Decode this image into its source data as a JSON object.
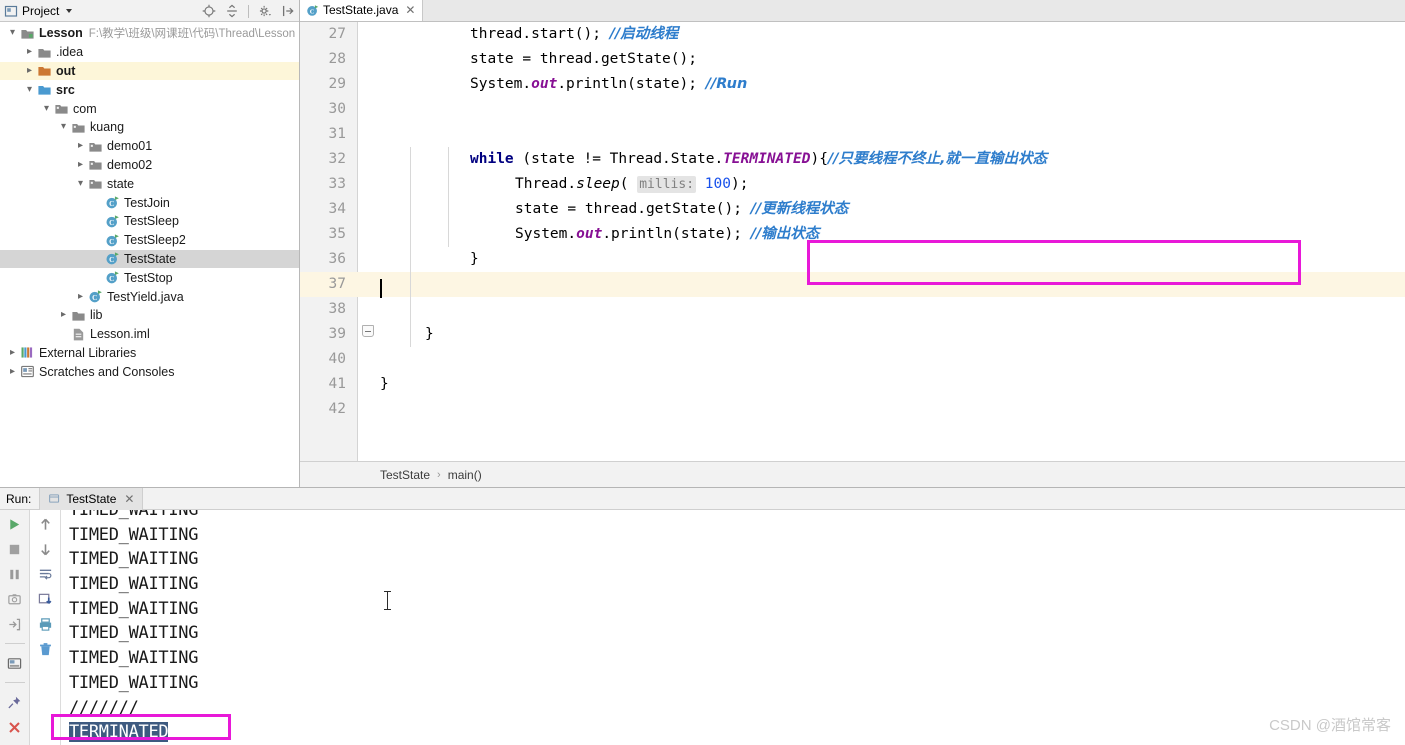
{
  "project_panel": {
    "title": "Project",
    "caret_icon": "chevron-down-icon",
    "tools": [
      {
        "name": "locate-icon",
        "title": "Select Opened File"
      },
      {
        "name": "collapse-all-icon",
        "title": "Collapse All"
      },
      {
        "name": "gear-icon",
        "title": "Settings"
      },
      {
        "name": "hide-icon",
        "title": "Hide"
      }
    ],
    "tree": [
      {
        "label": "Lesson",
        "path": "F:\\教学\\班级\\网课班\\代码\\Thread\\Lesson",
        "depth": 0,
        "arrow": "expanded",
        "icon": "module-icon",
        "bold": true,
        "state": "none"
      },
      {
        "label": ".idea",
        "path": "",
        "depth": 1,
        "arrow": "collapsed",
        "icon": "folder-icon",
        "bold": false,
        "state": "none"
      },
      {
        "label": "out",
        "path": "",
        "depth": 1,
        "arrow": "collapsed",
        "icon": "folder-orange-icon",
        "bold": true,
        "state": "highlight"
      },
      {
        "label": "src",
        "path": "",
        "depth": 1,
        "arrow": "expanded",
        "icon": "folder-source-icon",
        "bold": true,
        "state": "none"
      },
      {
        "label": "com",
        "path": "",
        "depth": 2,
        "arrow": "expanded",
        "icon": "package-icon",
        "bold": false,
        "state": "none"
      },
      {
        "label": "kuang",
        "path": "",
        "depth": 3,
        "arrow": "expanded",
        "icon": "package-icon",
        "bold": false,
        "state": "none"
      },
      {
        "label": "demo01",
        "path": "",
        "depth": 4,
        "arrow": "collapsed",
        "icon": "package-icon",
        "bold": false,
        "state": "none"
      },
      {
        "label": "demo02",
        "path": "",
        "depth": 4,
        "arrow": "collapsed",
        "icon": "package-icon",
        "bold": false,
        "state": "none"
      },
      {
        "label": "state",
        "path": "",
        "depth": 4,
        "arrow": "expanded",
        "icon": "package-icon",
        "bold": false,
        "state": "none"
      },
      {
        "label": "TestJoin",
        "path": "",
        "depth": 5,
        "arrow": "none",
        "icon": "java-class-icon",
        "bold": false,
        "state": "none"
      },
      {
        "label": "TestSleep",
        "path": "",
        "depth": 5,
        "arrow": "none",
        "icon": "java-class-icon",
        "bold": false,
        "state": "none"
      },
      {
        "label": "TestSleep2",
        "path": "",
        "depth": 5,
        "arrow": "none",
        "icon": "java-class-icon",
        "bold": false,
        "state": "none"
      },
      {
        "label": "TestState",
        "path": "",
        "depth": 5,
        "arrow": "none",
        "icon": "java-class-icon",
        "bold": false,
        "state": "selected"
      },
      {
        "label": "TestStop",
        "path": "",
        "depth": 5,
        "arrow": "none",
        "icon": "java-class-icon",
        "bold": false,
        "state": "none"
      },
      {
        "label": "TestYield.java",
        "path": "",
        "depth": 4,
        "arrow": "collapsed",
        "icon": "java-class-icon",
        "bold": false,
        "state": "none"
      },
      {
        "label": "lib",
        "path": "",
        "depth": 3,
        "arrow": "collapsed",
        "icon": "folder-icon",
        "bold": false,
        "state": "none"
      },
      {
        "label": "Lesson.iml",
        "path": "",
        "depth": 3,
        "arrow": "none",
        "icon": "iml-file-icon",
        "bold": false,
        "state": "none"
      },
      {
        "label": "External Libraries",
        "path": "",
        "depth": 0,
        "arrow": "collapsed",
        "icon": "libraries-icon",
        "bold": false,
        "state": "none"
      },
      {
        "label": "Scratches and Consoles",
        "path": "",
        "depth": 0,
        "arrow": "collapsed",
        "icon": "scratches-icon",
        "bold": false,
        "state": "none"
      }
    ]
  },
  "editor": {
    "tab": {
      "label": "TestState.java",
      "icon": "java-class-icon",
      "close_icon": "close-icon"
    },
    "lines": [
      {
        "num": "27",
        "caret": false
      },
      {
        "num": "28",
        "caret": false
      },
      {
        "num": "29",
        "caret": false
      },
      {
        "num": "30",
        "caret": false
      },
      {
        "num": "31",
        "caret": false
      },
      {
        "num": "32",
        "caret": false
      },
      {
        "num": "33",
        "caret": false
      },
      {
        "num": "34",
        "caret": false
      },
      {
        "num": "35",
        "caret": false
      },
      {
        "num": "36",
        "caret": false
      },
      {
        "num": "37",
        "caret": true
      },
      {
        "num": "38",
        "caret": false
      },
      {
        "num": "39",
        "caret": false
      },
      {
        "num": "40",
        "caret": false
      },
      {
        "num": "41",
        "caret": false
      },
      {
        "num": "42",
        "caret": false
      }
    ],
    "code": {
      "l27": {
        "code": "thread.start();",
        "comment": "//启动线程"
      },
      "l28": {
        "code": "state = thread.getState();"
      },
      "l29": {
        "pre": "System.",
        "field": "out",
        "post": ".println(state);",
        "comment": "//Run"
      },
      "l32": {
        "kw": "while",
        "cond": " (state != Thread.State.",
        "constant": "TERMINATED",
        "tail": "){",
        "comment": "//只要线程不终止,就一直输出状态"
      },
      "l33": {
        "pre": "Thread.",
        "method": "sleep",
        "paren": "( ",
        "hint": "millis:",
        "value": "100",
        "tail": ");"
      },
      "l34": {
        "code": "state = thread.getState();",
        "comment": "//更新线程状态"
      },
      "l35": {
        "pre": "System.",
        "field": "out",
        "post": ".println(state);",
        "comment": "//输出状态"
      },
      "l36": {
        "code": "}"
      },
      "l39": {
        "code": "}"
      },
      "l41": {
        "code": "}"
      }
    },
    "breadcrumbs": [
      "TestState",
      "main()"
    ],
    "breadcrumb_separator": "›",
    "annotation_color": "#E818D8"
  },
  "run_panel": {
    "label": "Run:",
    "tab": {
      "label": "TestState",
      "icon": "run-config-icon",
      "close_icon": "close-icon"
    },
    "toolbar_left": [
      {
        "name": "rerun-icon",
        "title": "Rerun"
      },
      {
        "name": "stop-icon",
        "title": "Stop"
      },
      {
        "name": "pause-icon",
        "title": "Pause Output"
      },
      {
        "name": "dump-threads-icon",
        "title": "Dump Threads"
      },
      {
        "name": "exit-icon",
        "title": "Exit"
      },
      {
        "name": "console-view-icon",
        "title": "Console"
      },
      {
        "name": "pin-icon",
        "title": "Pin Tab"
      },
      {
        "name": "close-icon",
        "title": "Close"
      }
    ],
    "toolbar_right": [
      {
        "name": "up-arrow-icon",
        "title": "Up"
      },
      {
        "name": "down-arrow-icon",
        "title": "Down"
      },
      {
        "name": "soft-wrap-icon",
        "title": "Use Soft Wraps"
      },
      {
        "name": "scroll-to-end-icon",
        "title": "Scroll to End"
      },
      {
        "name": "print-icon",
        "title": "Print"
      },
      {
        "name": "trash-icon",
        "title": "Clear All"
      }
    ],
    "console_lines": [
      {
        "text": "TIMED_WAITING",
        "selected": false,
        "clipped": true
      },
      {
        "text": "TIMED_WAITING",
        "selected": false,
        "clipped": false
      },
      {
        "text": "TIMED_WAITING",
        "selected": false,
        "clipped": false
      },
      {
        "text": "TIMED_WAITING",
        "selected": false,
        "clipped": false
      },
      {
        "text": "TIMED_WAITING",
        "selected": false,
        "clipped": false
      },
      {
        "text": "TIMED_WAITING",
        "selected": false,
        "clipped": false
      },
      {
        "text": "TIMED_WAITING",
        "selected": false,
        "clipped": false
      },
      {
        "text": "TIMED_WAITING",
        "selected": false,
        "clipped": false
      },
      {
        "text": "///////",
        "selected": false,
        "clipped": false
      },
      {
        "text": "TERMINATED",
        "selected": true,
        "clipped": false
      }
    ]
  },
  "watermark": "CSDN @酒馆常客"
}
